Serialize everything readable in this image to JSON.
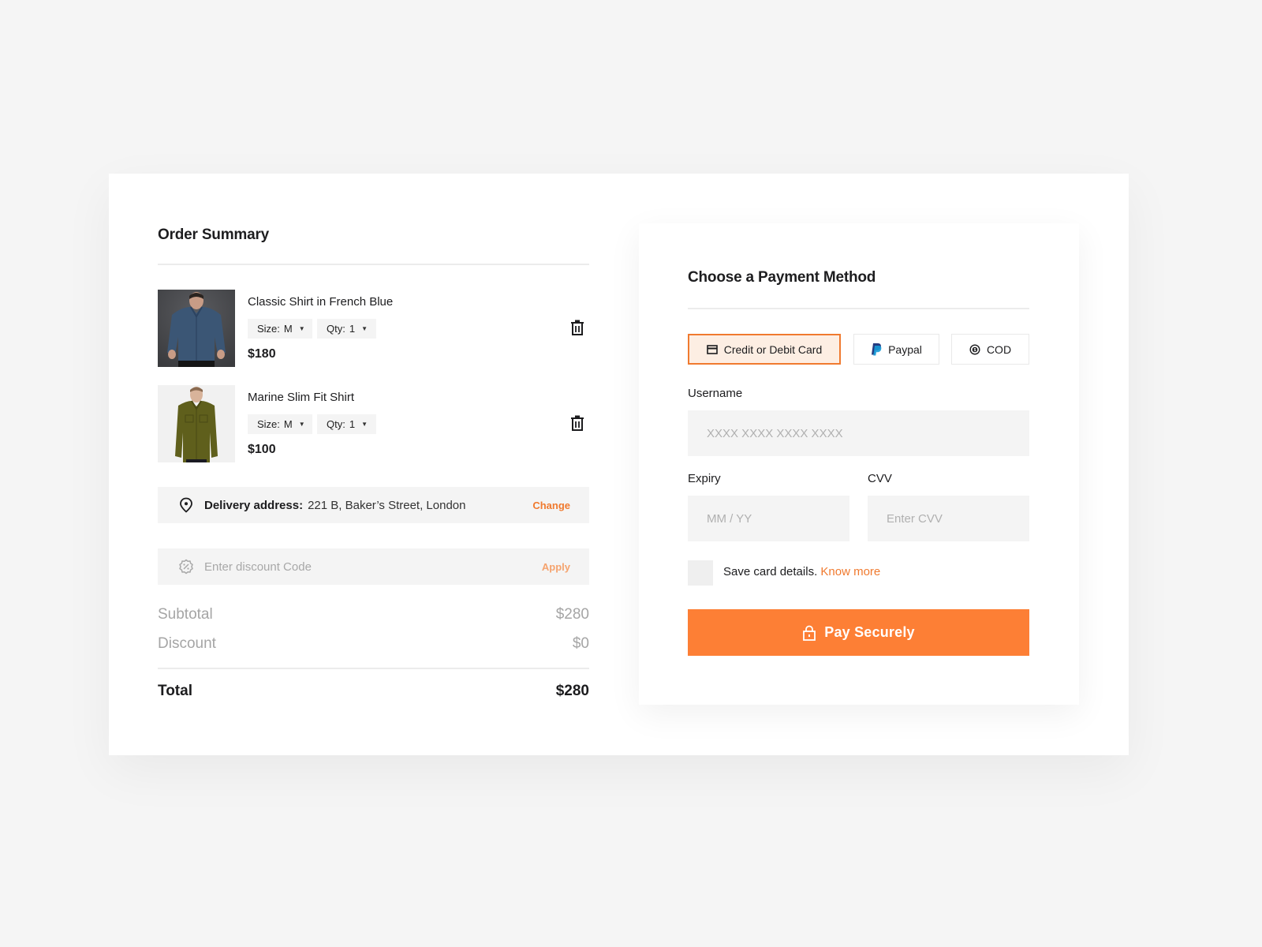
{
  "order_summary": {
    "title": "Order Summary",
    "items": [
      {
        "name": "Classic Shirt in French Blue",
        "size_label": "Size:",
        "size_value": "M",
        "qty_label": "Qty:",
        "qty_value": "1",
        "price": "$180",
        "image_icon": "shirt-blue-photo"
      },
      {
        "name": "Marine Slim Fit Shirt",
        "size_label": "Size:",
        "size_value": "M",
        "qty_label": "Qty:",
        "qty_value": "1",
        "price": "$100",
        "image_icon": "shirt-olive-photo"
      }
    ],
    "delivery": {
      "label": "Delivery address:",
      "value": "221 B, Baker’s Street, London",
      "change_label": "Change",
      "icon": "location-pin-icon"
    },
    "discount": {
      "placeholder": "Enter discount Code",
      "value": "",
      "apply_label": "Apply",
      "icon": "discount-badge-icon"
    },
    "subtotal": {
      "label": "Subtotal",
      "value": "$280"
    },
    "discount_row": {
      "label": "Discount",
      "value": "$0"
    },
    "total": {
      "label": "Total",
      "value": "$280"
    }
  },
  "payment": {
    "title": "Choose a Payment Method",
    "methods": [
      {
        "label": "Credit or Debit Card",
        "icon": "credit-card-icon",
        "selected": true
      },
      {
        "label": "Paypal",
        "icon": "paypal-icon",
        "selected": false
      },
      {
        "label": "COD",
        "icon": "cash-coin-icon",
        "selected": false
      }
    ],
    "username": {
      "label": "Username",
      "placeholder": "XXXX XXXX XXXX XXXX",
      "value": ""
    },
    "expiry": {
      "label": "Expiry",
      "placeholder": "MM / YY",
      "value": ""
    },
    "cvv": {
      "label": "CVV",
      "placeholder": "Enter CVV",
      "value": ""
    },
    "save_card": {
      "text": "Save card details.",
      "link": "Know more",
      "checked": false
    },
    "pay_button": {
      "label": "Pay Securely",
      "icon": "lock-icon"
    }
  },
  "colors": {
    "accent": "#fd7f35",
    "accent_text": "#f07a2f",
    "accent_light": "#fdeee3",
    "field_bg": "#f4f4f4",
    "page_bg": "#f5f5f5"
  }
}
